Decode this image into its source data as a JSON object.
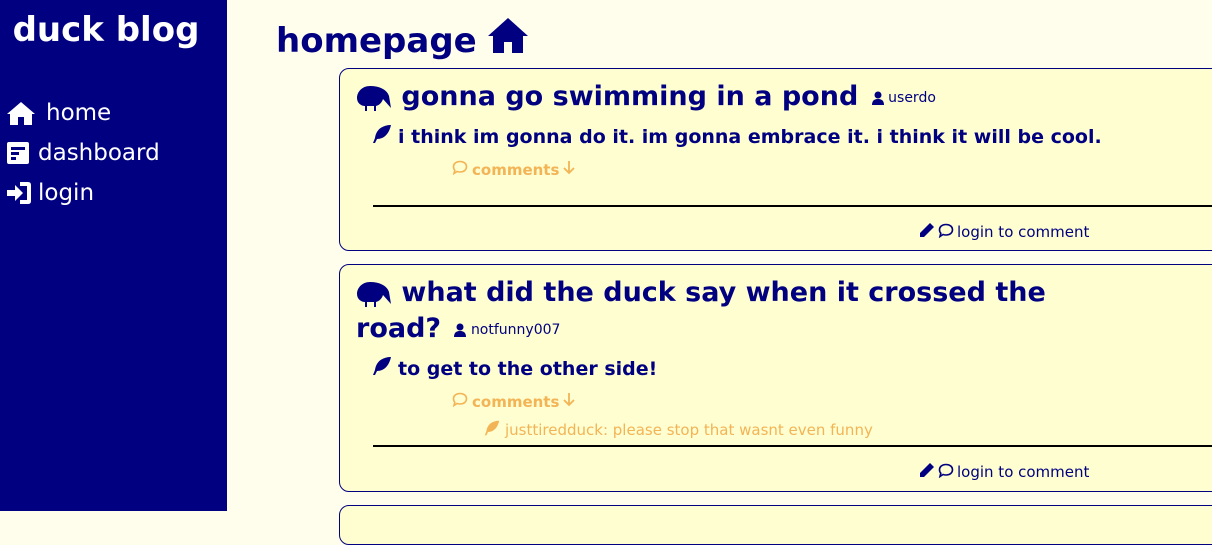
{
  "sidebar": {
    "brand": "duck blog",
    "items": [
      {
        "label": "home",
        "icon": "home-icon"
      },
      {
        "label": "dashboard",
        "icon": "dashboard-icon"
      },
      {
        "label": "login",
        "icon": "login-icon"
      }
    ]
  },
  "main": {
    "title": "homepage",
    "title_icon": "home-icon"
  },
  "posts": [
    {
      "title": "gonna go swimming in a pond",
      "author": "userdo",
      "body": "i think im gonna do it. im gonna embrace it. i think it will be cool.",
      "comments_label": "comments",
      "comments": [],
      "login_label": "login to comment"
    },
    {
      "title_line1": "what did the duck say when it crossed the",
      "title_line2": "road?",
      "author": "notfunny007",
      "body": "to get to the other side!",
      "comments_label": "comments",
      "comments": [
        {
          "text": "justtiredduck: please stop that wasnt even funny"
        }
      ],
      "login_label": "login to comment"
    }
  ],
  "colors": {
    "sidebar_bg": "#000080",
    "page_bg": "#fffeed",
    "card_bg": "#fefed0",
    "accent": "#f3b456"
  }
}
